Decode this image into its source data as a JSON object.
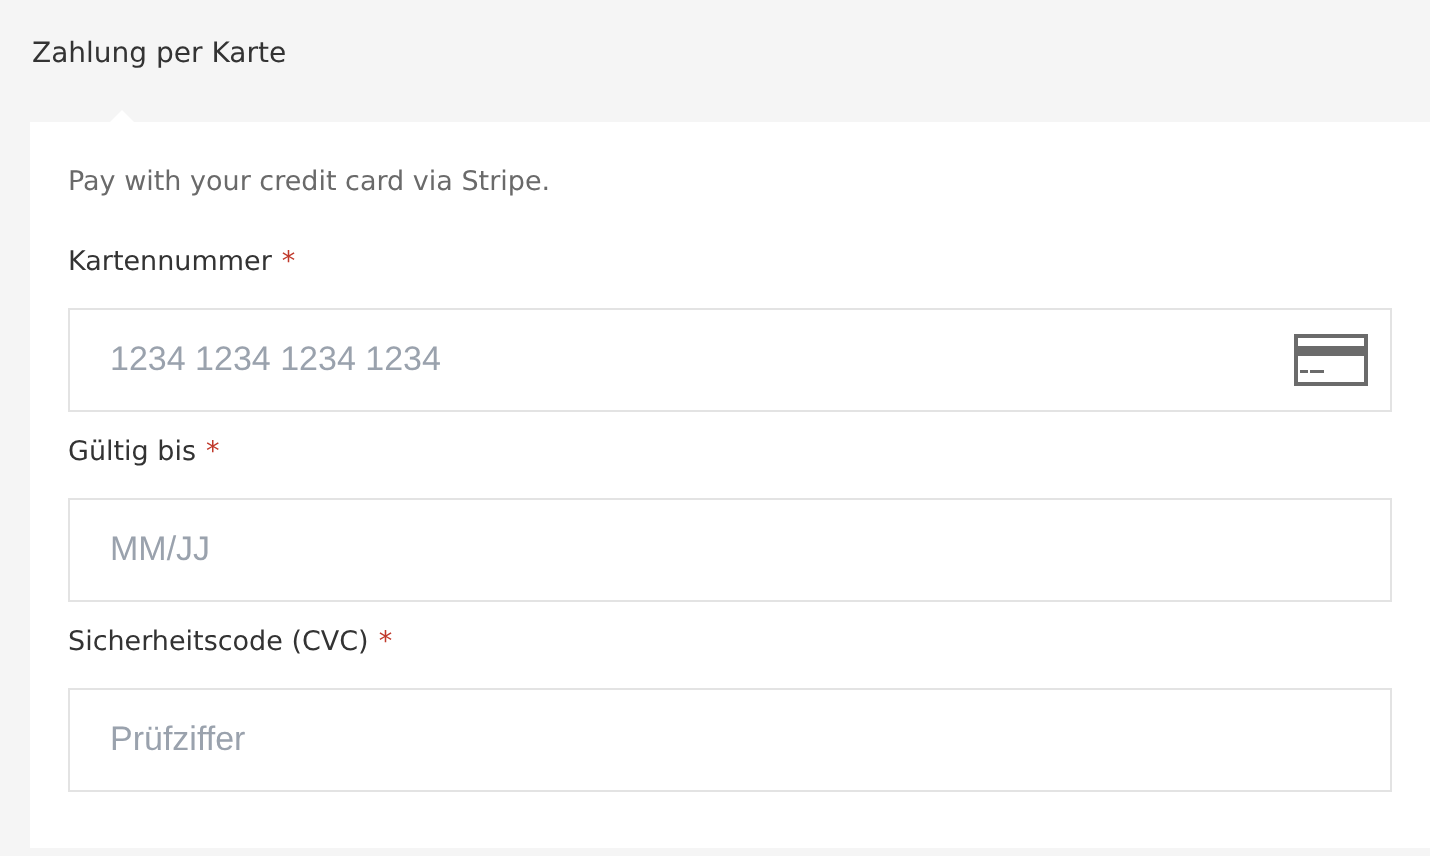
{
  "section_title": "Zahlung per Karte",
  "description": "Pay with your credit card via Stripe.",
  "fields": [
    {
      "label": "Kartennummer",
      "required_mark": "*",
      "placeholder": "1234 1234 1234 1234",
      "card_icon": true
    },
    {
      "label": "Gültig bis",
      "required_mark": "*",
      "placeholder": "MM/JJ",
      "card_icon": false
    },
    {
      "label": "Sicherheitscode (CVC)",
      "required_mark": "*",
      "placeholder": "Prüfziffer",
      "card_icon": false
    }
  ]
}
